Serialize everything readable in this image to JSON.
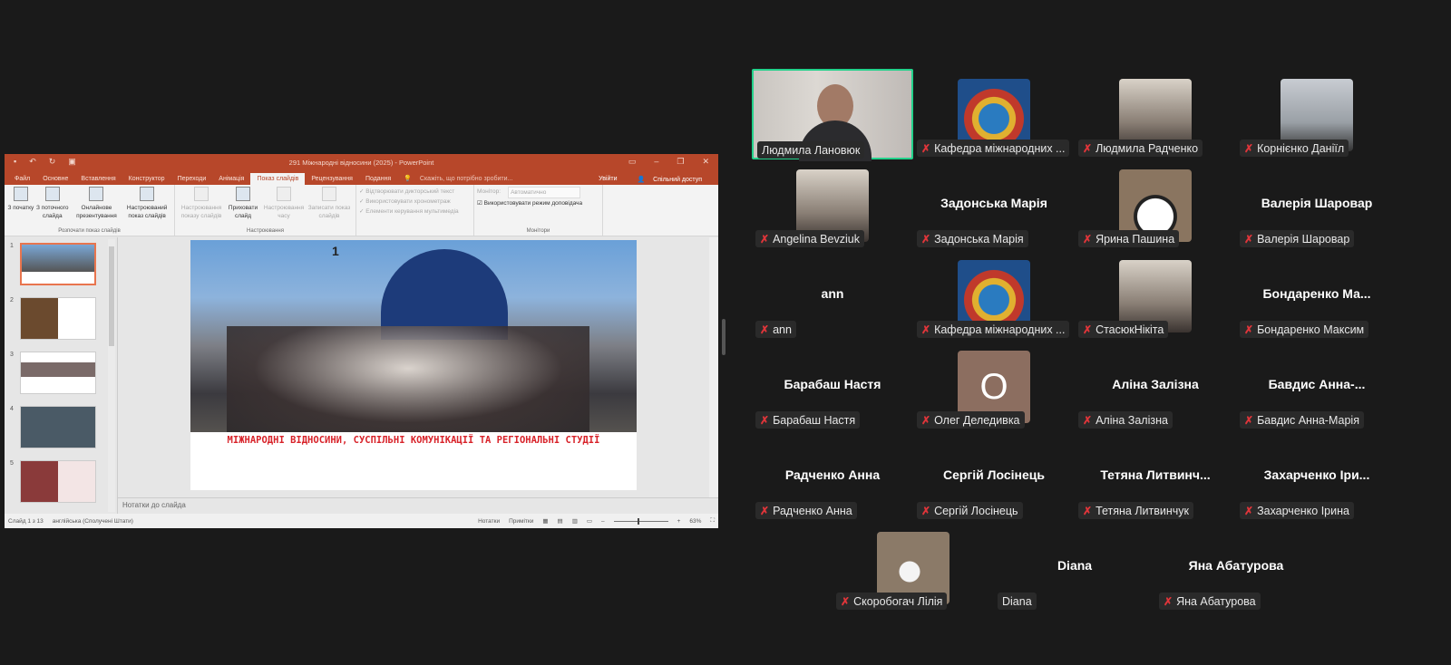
{
  "powerpoint": {
    "title": "291 Міжнародні відносини (2025) - PowerPoint",
    "tabs": [
      "Файл",
      "Основне",
      "Вставлення",
      "Конструктор",
      "Переходи",
      "Анімація",
      "Показ слайдів",
      "Рецензування",
      "Подання"
    ],
    "active_tab": "Показ слайдів",
    "tell_me": "Скажіть, що потрібно зробити...",
    "sign_in": "Увійти",
    "share": "Спільний доступ",
    "ribbon": {
      "start_group": "Розпочати показ слайдів",
      "from_beginning": "З початку",
      "from_current": "З поточного слайда",
      "online": "Онлайнове презентування",
      "custom": "Настроюваний показ слайдів",
      "setup_show": "Настроювання показу слайдів",
      "hide_slide": "Приховати слайд",
      "rehearse": "Настроювання часу",
      "record": "Записати показ слайдів",
      "setup_group": "Настроювання",
      "play_narrations": "Відтворювати дикторський текст",
      "use_timings": "Використовувати хронометраж",
      "media_controls": "Елементи керування мультимедіа",
      "monitor_label": "Монітор:",
      "monitor_value": "Автоматично",
      "presenter_view": "Використовувати режим доповідача",
      "monitors_group": "Монітори"
    },
    "slide_numbers": [
      "1",
      "2",
      "3",
      "4",
      "5"
    ],
    "slide": {
      "number": "1",
      "title": "МІЖНАРОДНІ ВІДНОСИНИ, СУСПІЛЬНІ КОМУНІКАЦІЇ ТА РЕГІОНАЛЬНІ СТУДІЇ"
    },
    "notes_placeholder": "Нотатки до слайда",
    "status": {
      "slide_count": "Слайд 1 з 13",
      "language": "англійська (Сполучені Штати)",
      "notes": "Нотатки",
      "comments": "Примітки",
      "zoom": "63%"
    },
    "accent": "#b7472a"
  },
  "participants": [
    {
      "name": "Людмила Лановюк",
      "muted": false,
      "tile": "video",
      "active": true
    },
    {
      "name": "Кафедра міжнародних ...",
      "muted": true,
      "tile": "avatar-globe"
    },
    {
      "name": "Людмила Радченко",
      "muted": true,
      "tile": "avatar-photo"
    },
    {
      "name": "Корнієнко Даніїл",
      "muted": true,
      "tile": "avatar-bike"
    },
    {
      "name": "Angelina Bevziuk",
      "muted": true,
      "tile": "avatar-photo"
    },
    {
      "name": "Задонська Марія",
      "display": "Задонська Марія",
      "muted": true
    },
    {
      "name": "Ярина Пашина",
      "muted": true,
      "tile": "avatar-panda"
    },
    {
      "name": "Валерія Шаровар",
      "display": "Валерія Шаровар",
      "muted": true
    },
    {
      "name": "ann",
      "display": "ann",
      "muted": true
    },
    {
      "name": "Кафедра міжнародних ...",
      "muted": true,
      "tile": "avatar-globe"
    },
    {
      "name": "СтасюкНікіта",
      "muted": true,
      "tile": "avatar-photo"
    },
    {
      "name": "Бондаренко Максим",
      "display": "Бондаренко  Ма...",
      "muted": true
    },
    {
      "name": "Барабаш Настя",
      "display": "Барабаш Настя",
      "muted": true
    },
    {
      "name": "Олег Деледивка",
      "muted": true,
      "tile": "avatar-letter",
      "letter": "О"
    },
    {
      "name": "Аліна Залізна",
      "display": "Аліна Залізна",
      "muted": true
    },
    {
      "name": "Бавдис Анна-Марія",
      "display": "Бавдис  Анна-...",
      "muted": true
    },
    {
      "name": "Радченко Анна",
      "display": "Радченко Анна",
      "muted": true
    },
    {
      "name": "Сергій Лосінець",
      "display": "Сергій Лосінець",
      "muted": true
    },
    {
      "name": "Тетяна Литвинчук",
      "display": "Тетяна  Литвинч...",
      "muted": true
    },
    {
      "name": "Захарченко Ірина",
      "display": "Захарченко Іри...",
      "muted": true
    },
    {
      "name": "Скоробогач Лілія",
      "muted": true,
      "tile": "avatar-cat"
    },
    {
      "name": "Diana",
      "display": "Diana",
      "muted": false
    },
    {
      "name": "Яна Абатурова",
      "display": "Яна Абатурова",
      "muted": true
    }
  ],
  "colors": {
    "background": "#1a1a1a",
    "active_speaker": "#23d18b",
    "muted_icon": "#e0353a"
  }
}
